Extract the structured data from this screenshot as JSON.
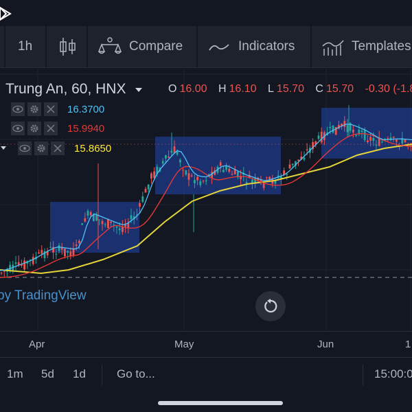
{
  "toolbar": {
    "interval": "1h",
    "compare": "Compare",
    "indicators": "Indicators",
    "templates": "Templates"
  },
  "legend": {
    "title": "Trung An, 60, HNX",
    "open_label": "O",
    "open": "16.00",
    "high_label": "H",
    "high": "16.10",
    "low_label": "L",
    "low": "15.70",
    "close_label": "C",
    "close": "15.70",
    "change": "-0.30 (-1.8"
  },
  "indicators": [
    {
      "value": "16.3700",
      "color": "#4fc3f7"
    },
    {
      "value": "15.9940",
      "color": "#e53935"
    },
    {
      "value": "15.8650",
      "color": "#ffeb3b"
    }
  ],
  "watermark": "by TradingView",
  "time_axis": {
    "labels": [
      "Apr",
      "May",
      "Jun",
      "1"
    ]
  },
  "bottombar": {
    "ranges": [
      "1m",
      "5d",
      "1d"
    ],
    "goto": "Go to...",
    "time": "15:00:0"
  },
  "colors": {
    "background": "#131722",
    "up_candle": "#26a69a",
    "down_candle": "#ef5350",
    "highlight_box": "#1e3a8a"
  }
}
